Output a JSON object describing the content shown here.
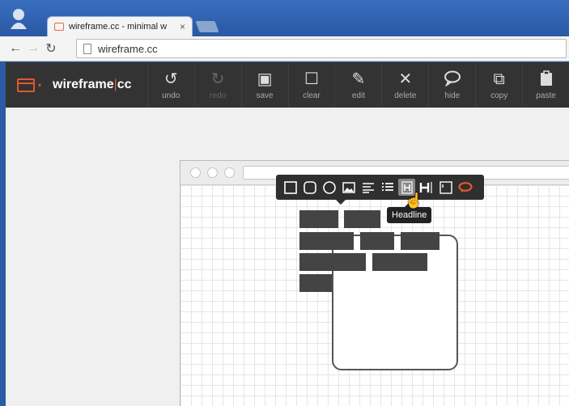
{
  "browser": {
    "tab_title": "wireframe.cc - minimal w",
    "tab_close": "×",
    "url": "wireframe.cc"
  },
  "app": {
    "brand_left": "wireframe",
    "brand_sep": "|",
    "brand_right": "cc",
    "accent": "#e0582c",
    "tools": [
      {
        "label": "undo",
        "icon": "↺",
        "name": "undo",
        "disabled": false
      },
      {
        "label": "redo",
        "icon": "↻",
        "name": "redo",
        "disabled": true
      },
      {
        "label": "save",
        "icon": "▣",
        "name": "save",
        "disabled": false
      },
      {
        "label": "clear",
        "icon": "☐",
        "name": "clear",
        "disabled": false
      },
      {
        "label": "edit",
        "icon": "✎",
        "name": "edit",
        "disabled": false
      },
      {
        "label": "delete",
        "icon": "✕",
        "name": "delete",
        "disabled": false
      },
      {
        "label": "hide",
        "icon": "💬",
        "name": "hide",
        "disabled": false
      },
      {
        "label": "copy",
        "icon": "⧉",
        "name": "copy",
        "disabled": false
      },
      {
        "label": "paste",
        "icon": "📋",
        "name": "paste",
        "disabled": false
      }
    ]
  },
  "context_menu": {
    "items": [
      "rectangle",
      "rounded-rectangle",
      "circle",
      "image",
      "paragraph",
      "list",
      "headline",
      "heading",
      "browser-window",
      "comment"
    ],
    "tooltip": "Headline"
  }
}
